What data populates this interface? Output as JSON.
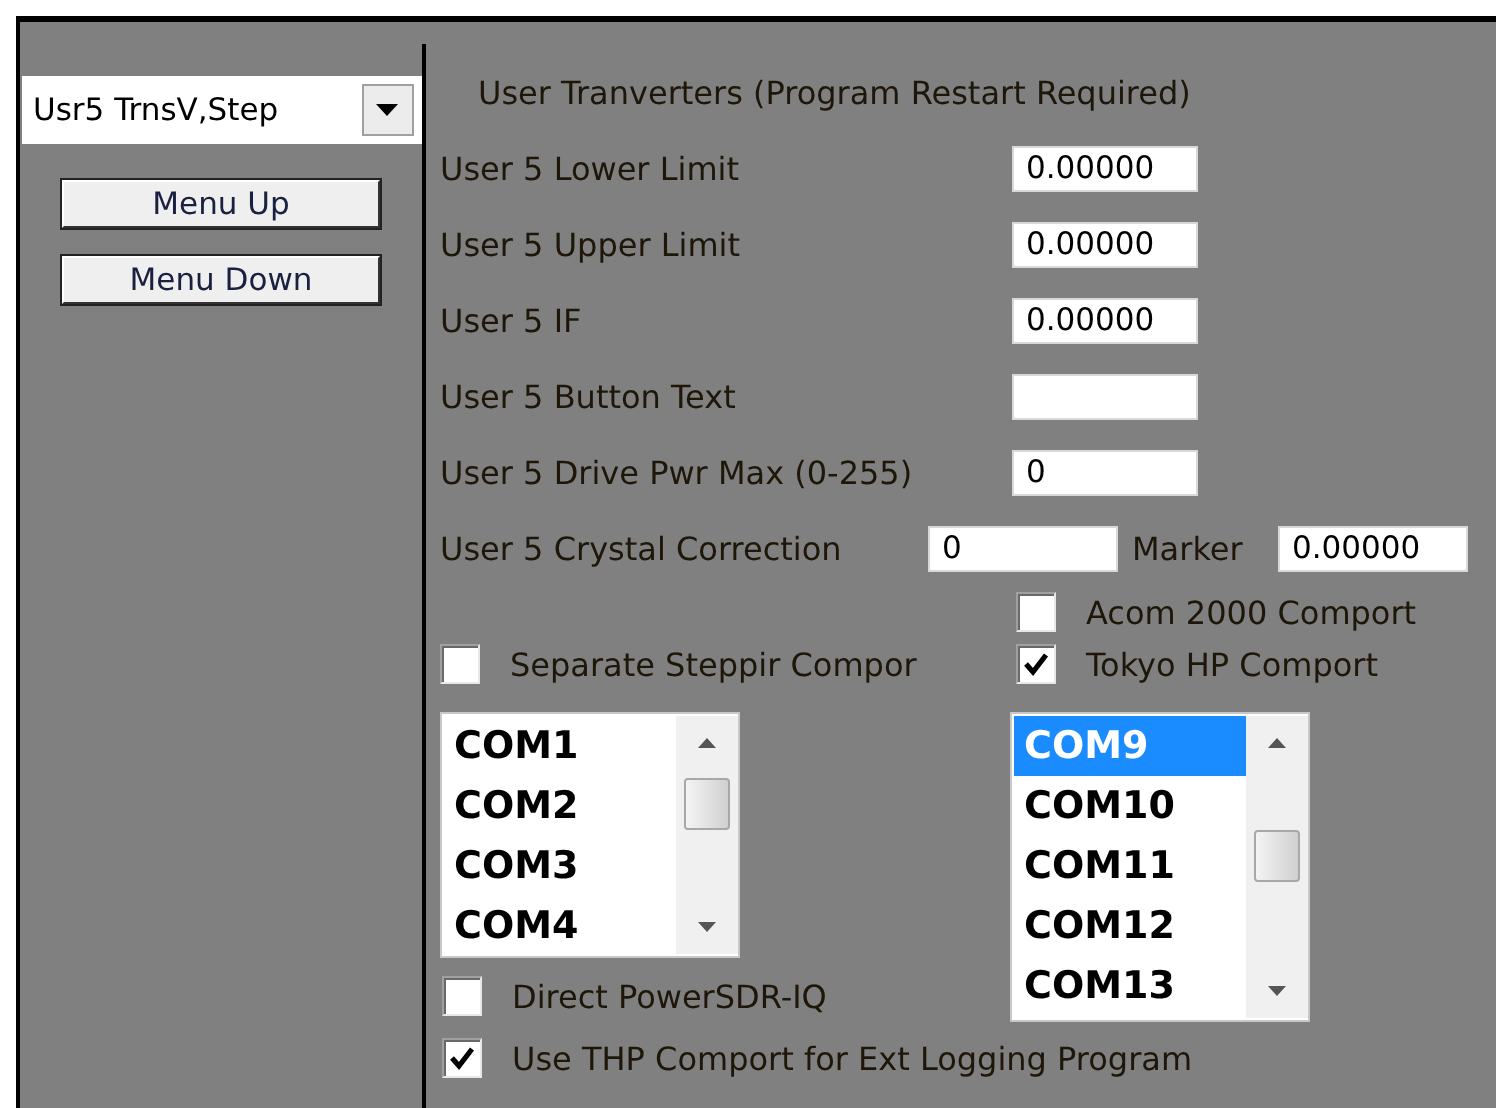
{
  "dropdown": {
    "value": "Usr5 TrnsV,Step"
  },
  "buttons": [
    "Menu Up",
    "Menu Down"
  ],
  "section_title": "User Tranverters (Program Restart Required)",
  "fields": [
    {
      "label": "User 5 Lower Limit",
      "value": "0.00000"
    },
    {
      "label": "User 5 Upper Limit",
      "value": "0.00000"
    },
    {
      "label": "User 5 IF",
      "value": "0.00000"
    },
    {
      "label": "User 5 Button Text"
    },
    {
      "label": "User 5 Drive Pwr Max (0-255)",
      "value": "0"
    }
  ],
  "crystal": {
    "label": "User 5 Crystal Correction",
    "value": "0",
    "marker_label": "Marker",
    "marker_value": "0.00000"
  },
  "acom_comport": {
    "label": "Acom 2000 Comport",
    "checked": false
  },
  "separate_steppir": {
    "label": "Separate Steppir Compor",
    "checked": false
  },
  "tokyo_hp_comport": {
    "label": "Tokyo HP Comport",
    "checked": true
  },
  "port_lists": [
    {
      "items": [
        {
          "label": "COM1",
          "selected": false
        },
        {
          "label": "COM2",
          "selected": false
        },
        {
          "label": "COM3",
          "selected": false
        },
        {
          "label": "COM4",
          "selected": false
        }
      ]
    },
    {
      "items": [
        {
          "label": "COM9",
          "selected": true
        },
        {
          "label": "COM10",
          "selected": false
        },
        {
          "label": "COM11",
          "selected": false
        },
        {
          "label": "COM12",
          "selected": false
        },
        {
          "label": "COM13",
          "selected": false
        }
      ]
    }
  ],
  "direct_powersdr": {
    "label": "Direct PowerSDR-IQ",
    "checked": false
  },
  "use_thp_logging": {
    "label": "Use THP Comport for Ext Logging Program",
    "checked": true
  }
}
